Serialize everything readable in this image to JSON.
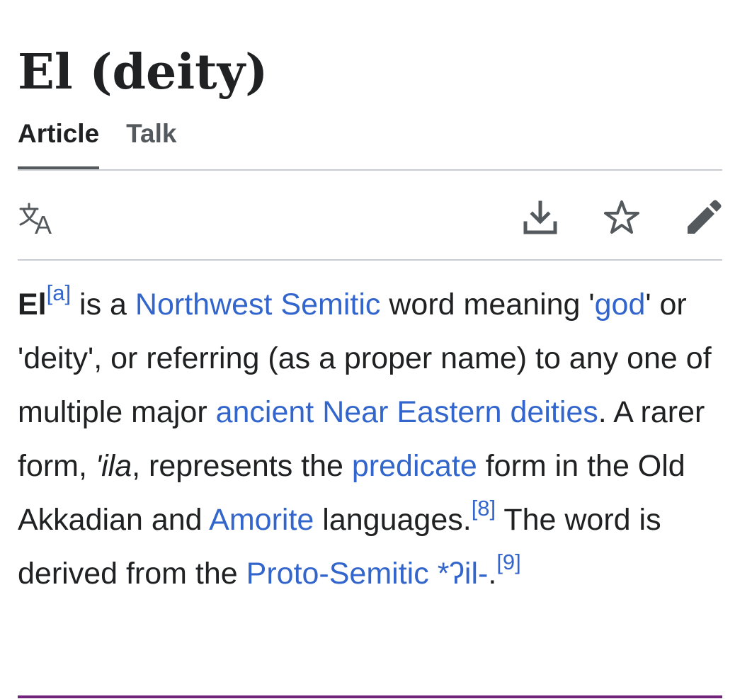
{
  "page": {
    "title": "El (deity)"
  },
  "tabs": [
    {
      "label": "Article",
      "active": true
    },
    {
      "label": "Talk",
      "active": false
    }
  ],
  "toolbar": {
    "icons": [
      "language-icon",
      "download-icon",
      "star-icon",
      "edit-pencil-icon"
    ]
  },
  "article": {
    "term": "El",
    "note_a": "[a]",
    "t1": " is a ",
    "link_northwest_semitic": "Northwest Semitic",
    "t2": " word meaning '",
    "link_god": "god",
    "t3": "' or 'deity', or referring (as a proper name) to any one of multiple major ",
    "link_ancient_deities": "ancient Near Eastern deities",
    "t4": ". A rarer form, ",
    "ila": "'ila",
    "t5": ", represents the ",
    "link_predicate": "predicate",
    "t6": " form in the Old Akkadian and ",
    "link_amorite": "Amorite",
    "t7": " languages.",
    "ref_8": "[8]",
    "t8": " The word is derived from the ",
    "link_proto_semitic": "Proto-Semitic",
    "t9": " ",
    "link_il": "*ʔil-",
    "t10": ".",
    "ref_9": "[9]"
  },
  "colors": {
    "link": "#3366cc",
    "text": "#202122",
    "tab_inactive": "#54595d",
    "divider": "#c8ccd1",
    "bottom_rule": "#72237b"
  }
}
